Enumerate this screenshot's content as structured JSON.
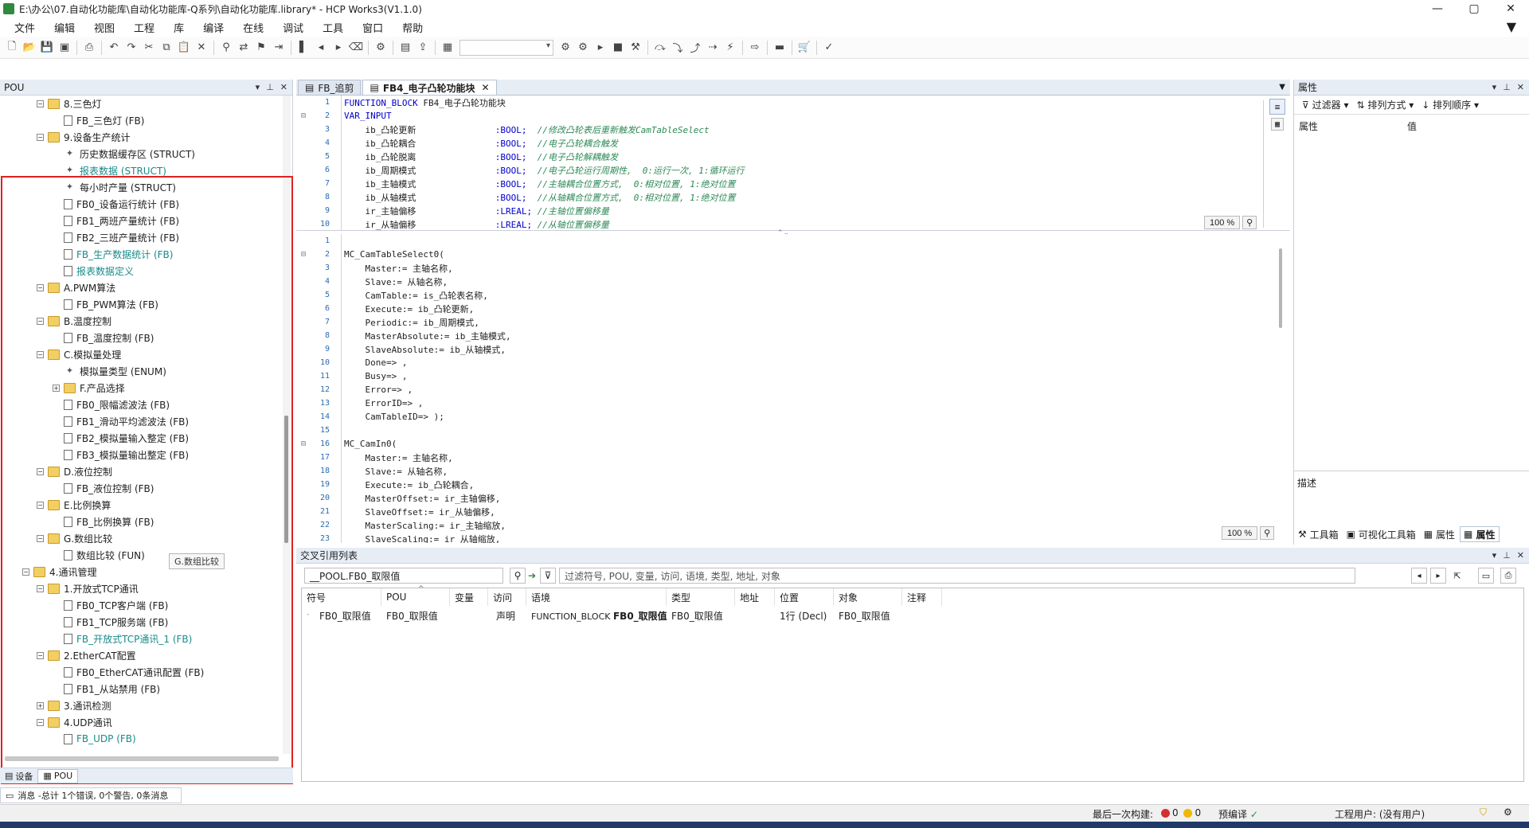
{
  "window": {
    "title": "E:\\办公\\07.自动化功能库\\自动化功能库-Q系列\\自动化功能库.library* - HCP Works3(V1.1.0)",
    "minimize": "—",
    "maximize": "▢",
    "close": "✕"
  },
  "menu": [
    "文件",
    "编辑",
    "视图",
    "工程",
    "库",
    "编译",
    "在线",
    "调试",
    "工具",
    "窗口",
    "帮助"
  ],
  "pou_panel": {
    "title": "POU",
    "tree": [
      {
        "depth": 1,
        "expander": "−",
        "icon": "folder",
        "label": "8.三色灯",
        "teal": false
      },
      {
        "depth": 2,
        "expander": "",
        "icon": "doc",
        "label": "FB_三色灯 (FB)",
        "teal": false
      },
      {
        "depth": 1,
        "expander": "−",
        "icon": "folder",
        "label": "9.设备生产统计",
        "teal": false
      },
      {
        "depth": 2,
        "expander": "",
        "icon": "struct",
        "label": "历史数据缓存区 (STRUCT)",
        "teal": false
      },
      {
        "depth": 2,
        "expander": "",
        "icon": "struct",
        "label": "报表数据 (STRUCT)",
        "teal": true
      },
      {
        "depth": 2,
        "expander": "",
        "icon": "struct",
        "label": "每小时产量 (STRUCT)",
        "teal": false
      },
      {
        "depth": 2,
        "expander": "",
        "icon": "doc",
        "label": "FB0_设备运行统计 (FB)",
        "teal": false
      },
      {
        "depth": 2,
        "expander": "",
        "icon": "doc",
        "label": "FB1_两班产量统计 (FB)",
        "teal": false
      },
      {
        "depth": 2,
        "expander": "",
        "icon": "doc",
        "label": "FB2_三班产量统计 (FB)",
        "teal": false
      },
      {
        "depth": 2,
        "expander": "",
        "icon": "doc",
        "label": "FB_生产数据统计 (FB)",
        "teal": true
      },
      {
        "depth": 2,
        "expander": "",
        "icon": "doc",
        "label": "报表数据定义",
        "teal": true
      },
      {
        "depth": 1,
        "expander": "−",
        "icon": "folder",
        "label": "A.PWM算法",
        "teal": false
      },
      {
        "depth": 2,
        "expander": "",
        "icon": "doc",
        "label": "FB_PWM算法 (FB)",
        "teal": false
      },
      {
        "depth": 1,
        "expander": "−",
        "icon": "folder",
        "label": "B.温度控制",
        "teal": false
      },
      {
        "depth": 2,
        "expander": "",
        "icon": "doc",
        "label": "FB_温度控制 (FB)",
        "teal": false
      },
      {
        "depth": 1,
        "expander": "−",
        "icon": "folder",
        "label": "C.模拟量处理",
        "teal": false
      },
      {
        "depth": 2,
        "expander": "",
        "icon": "struct",
        "label": "模拟量类型 (ENUM)",
        "teal": false
      },
      {
        "depth": 2,
        "expander": "+",
        "icon": "folder",
        "label": "F.产品选择",
        "teal": false
      },
      {
        "depth": 2,
        "expander": "",
        "icon": "doc",
        "label": "FB0_限幅滤波法 (FB)",
        "teal": false
      },
      {
        "depth": 2,
        "expander": "",
        "icon": "doc",
        "label": "FB1_滑动平均滤波法 (FB)",
        "teal": false
      },
      {
        "depth": 2,
        "expander": "",
        "icon": "doc",
        "label": "FB2_模拟量输入整定 (FB)",
        "teal": false
      },
      {
        "depth": 2,
        "expander": "",
        "icon": "doc",
        "label": "FB3_模拟量输出整定 (FB)",
        "teal": false
      },
      {
        "depth": 1,
        "expander": "−",
        "icon": "folder",
        "label": "D.液位控制",
        "teal": false
      },
      {
        "depth": 2,
        "expander": "",
        "icon": "doc",
        "label": "FB_液位控制 (FB)",
        "teal": false
      },
      {
        "depth": 1,
        "expander": "−",
        "icon": "folder",
        "label": "E.比例换算",
        "teal": false
      },
      {
        "depth": 2,
        "expander": "",
        "icon": "doc",
        "label": "FB_比例换算 (FB)",
        "teal": false
      },
      {
        "depth": 1,
        "expander": "−",
        "icon": "folder",
        "label": "G.数组比较",
        "teal": false
      },
      {
        "depth": 2,
        "expander": "",
        "icon": "doc",
        "label": "数组比较 (FUN)",
        "teal": false
      },
      {
        "depth": 0,
        "expander": "−",
        "icon": "folder",
        "label": "4.通讯管理",
        "teal": false
      },
      {
        "depth": 1,
        "expander": "−",
        "icon": "folder",
        "label": "1.开放式TCP通讯",
        "teal": false
      },
      {
        "depth": 2,
        "expander": "",
        "icon": "doc",
        "label": "FB0_TCP客户端 (FB)",
        "teal": false
      },
      {
        "depth": 2,
        "expander": "",
        "icon": "doc",
        "label": "FB1_TCP服务端 (FB)",
        "teal": false
      },
      {
        "depth": 2,
        "expander": "",
        "icon": "doc",
        "label": "FB_开放式TCP通讯_1 (FB)",
        "teal": true
      },
      {
        "depth": 1,
        "expander": "−",
        "icon": "folder",
        "label": "2.EtherCAT配置",
        "teal": false
      },
      {
        "depth": 2,
        "expander": "",
        "icon": "doc",
        "label": "FB0_EtherCAT通讯配置 (FB)",
        "teal": false
      },
      {
        "depth": 2,
        "expander": "",
        "icon": "doc",
        "label": "FB1_从站禁用 (FB)",
        "teal": false
      },
      {
        "depth": 1,
        "expander": "+",
        "icon": "folder",
        "label": "3.通讯检测",
        "teal": false
      },
      {
        "depth": 1,
        "expander": "−",
        "icon": "folder",
        "label": "4.UDP通讯",
        "teal": false
      },
      {
        "depth": 2,
        "expander": "",
        "icon": "doc",
        "label": "FB_UDP (FB)",
        "teal": true
      }
    ],
    "tooltip": "G.数组比较",
    "tabs": [
      "设备",
      "POU"
    ]
  },
  "messages": "消息 -总计 1个错误, 0个警告, 0条消息",
  "editor": {
    "tabs": [
      {
        "label": "FB_追剪",
        "active": false
      },
      {
        "label": "FB4_电子凸轮功能块",
        "active": true
      }
    ],
    "top_zoom": "100 %",
    "bottom_zoom": "100 %",
    "declaration": [
      {
        "n": "1",
        "parts": [
          [
            "kw",
            "FUNCTION_BLOCK"
          ],
          [
            "",
            " FB4_电子凸轮功能块"
          ]
        ]
      },
      {
        "n": "2",
        "parts": [
          [
            "kw",
            "VAR_INPUT"
          ]
        ],
        "fold": true
      },
      {
        "n": "3",
        "parts": [
          [
            "",
            "    ib_凸轮更新               "
          ],
          [
            "kw",
            ":BOOL;"
          ],
          [
            "cm",
            "  //修改凸轮表后重新触发CamTableSelect"
          ]
        ]
      },
      {
        "n": "4",
        "parts": [
          [
            "",
            "    ib_凸轮耦合               "
          ],
          [
            "kw",
            ":BOOL;"
          ],
          [
            "cm",
            "  //电子凸轮耦合触发"
          ]
        ]
      },
      {
        "n": "5",
        "parts": [
          [
            "",
            "    ib_凸轮脱离               "
          ],
          [
            "kw",
            ":BOOL;"
          ],
          [
            "cm",
            "  //电子凸轮解耦触发"
          ]
        ]
      },
      {
        "n": "6",
        "parts": [
          [
            "",
            "    ib_周期模式               "
          ],
          [
            "kw",
            ":BOOL;"
          ],
          [
            "cm",
            "  //电子凸轮运行周期性,  0:运行一次, 1:循环运行"
          ]
        ]
      },
      {
        "n": "7",
        "parts": [
          [
            "",
            "    ib_主轴模式               "
          ],
          [
            "kw",
            ":BOOL;"
          ],
          [
            "cm",
            "  //主轴耦合位置方式,  0:相对位置, 1:绝对位置"
          ]
        ]
      },
      {
        "n": "8",
        "parts": [
          [
            "",
            "    ib_从轴模式               "
          ],
          [
            "kw",
            ":BOOL;"
          ],
          [
            "cm",
            "  //从轴耦合位置方式,  0:相对位置, 1:绝对位置"
          ]
        ]
      },
      {
        "n": "9",
        "parts": [
          [
            "",
            "    ir_主轴偏移               "
          ],
          [
            "kw",
            ":LREAL;"
          ],
          [
            "cm",
            " //主轴位置偏移量"
          ]
        ]
      },
      {
        "n": "10",
        "parts": [
          [
            "",
            "    ir_从轴偏移               "
          ],
          [
            "kw",
            ":LREAL;"
          ],
          [
            "cm",
            " //从轴位置偏移量"
          ]
        ]
      }
    ],
    "body": [
      {
        "n": "1",
        "text": ""
      },
      {
        "n": "2",
        "text": "MC_CamTableSelect0(",
        "fold": true
      },
      {
        "n": "3",
        "text": "    Master:= 主轴名称,"
      },
      {
        "n": "4",
        "text": "    Slave:= 从轴名称,"
      },
      {
        "n": "5",
        "text": "    CamTable:= is_凸轮表名称,"
      },
      {
        "n": "6",
        "text": "    Execute:= ib_凸轮更新,"
      },
      {
        "n": "7",
        "text": "    Periodic:= ib_周期模式,"
      },
      {
        "n": "8",
        "text": "    MasterAbsolute:= ib_主轴模式,"
      },
      {
        "n": "9",
        "text": "    SlaveAbsolute:= ib_从轴模式,"
      },
      {
        "n": "10",
        "text": "    Done=> ,"
      },
      {
        "n": "11",
        "text": "    Busy=> ,"
      },
      {
        "n": "12",
        "text": "    Error=> ,"
      },
      {
        "n": "13",
        "text": "    ErrorID=> ,"
      },
      {
        "n": "14",
        "text": "    CamTableID=> );"
      },
      {
        "n": "15",
        "text": ""
      },
      {
        "n": "16",
        "text": "MC_CamIn0(",
        "fold": true
      },
      {
        "n": "17",
        "text": "    Master:= 主轴名称,"
      },
      {
        "n": "18",
        "text": "    Slave:= 从轴名称,"
      },
      {
        "n": "19",
        "text": "    Execute:= ib_凸轮耦合,"
      },
      {
        "n": "20",
        "text": "    MasterOffset:= ir_主轴偏移,"
      },
      {
        "n": "21",
        "text": "    SlaveOffset:= ir_从轴偏移,"
      },
      {
        "n": "22",
        "text": "    MasterScaling:= ir_主轴缩放,"
      },
      {
        "n": "23",
        "text": "    SlaveScaling:= ir_从轴缩放,"
      }
    ]
  },
  "properties": {
    "title": "属性",
    "filter": "过滤器",
    "sort_by": "排列方式",
    "sort_order": "排列顺序",
    "col_property": "属性",
    "col_value": "值",
    "description": "描述",
    "tabs": [
      "工具箱",
      "可视化工具箱",
      "属性",
      "属性"
    ]
  },
  "xref": {
    "title": "交叉引用列表",
    "search_value": "__POOL.FB0_取限值",
    "filter_placeholder": "过滤符号, POU, 变量, 访问, 语境, 类型, 地址, 对象",
    "columns": [
      "符号",
      "POU",
      "变量",
      "访问",
      "语境",
      "类型",
      "地址",
      "位置",
      "对象",
      "注释"
    ],
    "row": {
      "symbol": "FB0_取限值",
      "pou": "FB0_取限值",
      "variable": "",
      "access": "声明",
      "context_prefix": "FUNCTION_BLOCK ",
      "context_bold": "FB0_取限值",
      "type": "FB0_取限值",
      "address": "",
      "position": "1行 (Decl)",
      "object": "FB0_取限值",
      "comment": ""
    }
  },
  "status": {
    "last_build": "最后一次构建:",
    "errors": "0",
    "warnings": "0",
    "precompile": "预编译",
    "user": "工程用户: (没有用户)"
  },
  "colors": {
    "accent_red": "#e02020",
    "teal_text": "#1a8a8a",
    "keyword": "#0000cc",
    "comment": "#2e8b57"
  }
}
